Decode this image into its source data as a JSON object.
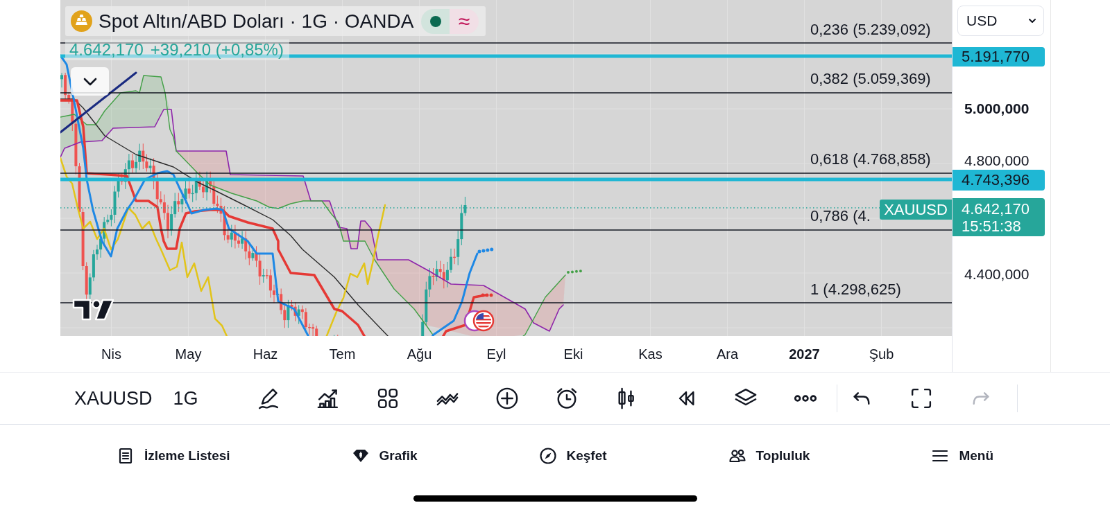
{
  "legend": {
    "title": "Spot Altın/ABD Doları · 1G · OANDA",
    "delay_symbol": "≈"
  },
  "quote": {
    "last": "4.642,170",
    "change": "+39,210 (+0,85%)"
  },
  "fib_levels": [
    {
      "label": "0,236 (5.239,092)"
    },
    {
      "label": "0,382 (5.059,369)"
    },
    {
      "label": "0,618 (4.768,858)"
    },
    {
      "label": "0,786 (4."
    },
    {
      "label": "1 (4.298,625)"
    }
  ],
  "price_scale": {
    "currency": "USD",
    "ticks": [
      {
        "label": "5.000,000",
        "kind": "major"
      },
      {
        "label": "4.800,000",
        "kind": "minor"
      },
      {
        "label": "4.400,000",
        "kind": "minor"
      }
    ],
    "tags": [
      {
        "kind": "line",
        "price": "5.191,770",
        "color": "#1fb7d4"
      },
      {
        "kind": "line",
        "price": "4.743,396",
        "color": "#1fb7d4"
      },
      {
        "kind": "last_price",
        "symbol": "XAUUSD",
        "price": "4.642,170",
        "countdown": "15:51:38",
        "color": "#26a69a"
      }
    ]
  },
  "time_scale": [
    {
      "label": "Nis",
      "kind": "month"
    },
    {
      "label": "May",
      "kind": "month"
    },
    {
      "label": "Haz",
      "kind": "month"
    },
    {
      "label": "Tem",
      "kind": "month"
    },
    {
      "label": "Ağu",
      "kind": "month"
    },
    {
      "label": "Eyl",
      "kind": "month"
    },
    {
      "label": "Eki",
      "kind": "month"
    },
    {
      "label": "Kas",
      "kind": "month"
    },
    {
      "label": "Ara",
      "kind": "month"
    },
    {
      "label": "2027",
      "kind": "year"
    },
    {
      "label": "Şub",
      "kind": "month"
    }
  ],
  "toolbar": {
    "symbol": "XAUUSD",
    "interval": "1G",
    "undo": {
      "disabled": false
    },
    "redo": {
      "disabled": true
    }
  },
  "bottom_nav": [
    {
      "label": "İzleme Listesi"
    },
    {
      "label": "Grafik"
    },
    {
      "label": "Keşfet"
    },
    {
      "label": "Topluluk"
    },
    {
      "label": "Menü"
    }
  ]
}
